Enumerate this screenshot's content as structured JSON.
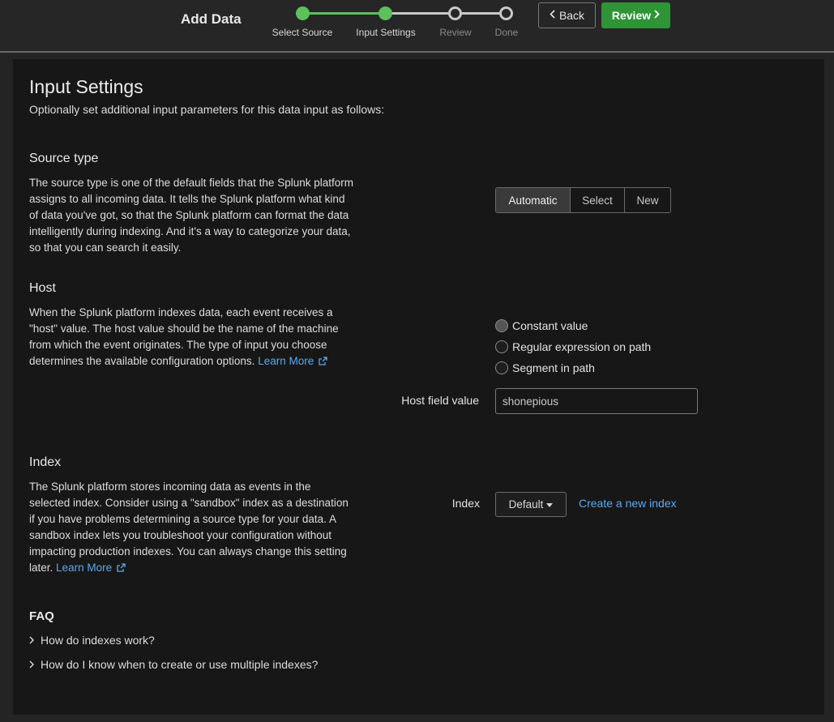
{
  "header": {
    "title": "Add Data",
    "back_label": "Back",
    "review_label": "Review",
    "accent_color": "#2e9436",
    "steps": [
      {
        "label": "Select Source",
        "state": "done"
      },
      {
        "label": "Input Settings",
        "state": "current"
      },
      {
        "label": "Review",
        "state": "todo"
      },
      {
        "label": "Done",
        "state": "todo"
      }
    ]
  },
  "page": {
    "title": "Input Settings",
    "subtitle": "Optionally set additional input parameters for this data input as follows:"
  },
  "source_type": {
    "title": "Source type",
    "text": "The source type is one of the default fields that the Splunk platform assigns to all incoming data. It tells the Splunk platform what kind of data you've got, so that the Splunk platform can format the data intelligently during indexing. And it's a way to categorize your data, so that you can search it easily.",
    "options": [
      "Automatic",
      "Select",
      "New"
    ],
    "selected": "Automatic"
  },
  "host": {
    "title": "Host",
    "text": "When the Splunk platform indexes data, each event receives a \"host\" value. The host value should be the name of the machine from which the event originates. The type of input you choose determines the available configuration options.",
    "learn_more": "Learn More",
    "radio_options": [
      "Constant value",
      "Regular expression on path",
      "Segment in path"
    ],
    "selected_radio": "Constant value",
    "field_label": "Host field value",
    "field_value": "shonepious"
  },
  "index": {
    "title": "Index",
    "text": "The Splunk platform stores incoming data as events in the selected index. Consider using a \"sandbox\" index as a destination if you have problems determining a source type for your data. A sandbox index lets you troubleshoot your configuration without impacting production indexes. You can always change this setting later.",
    "learn_more": "Learn More",
    "field_label": "Index",
    "dropdown_value": "Default",
    "create_link": "Create a new index"
  },
  "faq": {
    "title": "FAQ",
    "items": [
      "How do indexes work?",
      "How do I know when to create or use multiple indexes?"
    ]
  }
}
